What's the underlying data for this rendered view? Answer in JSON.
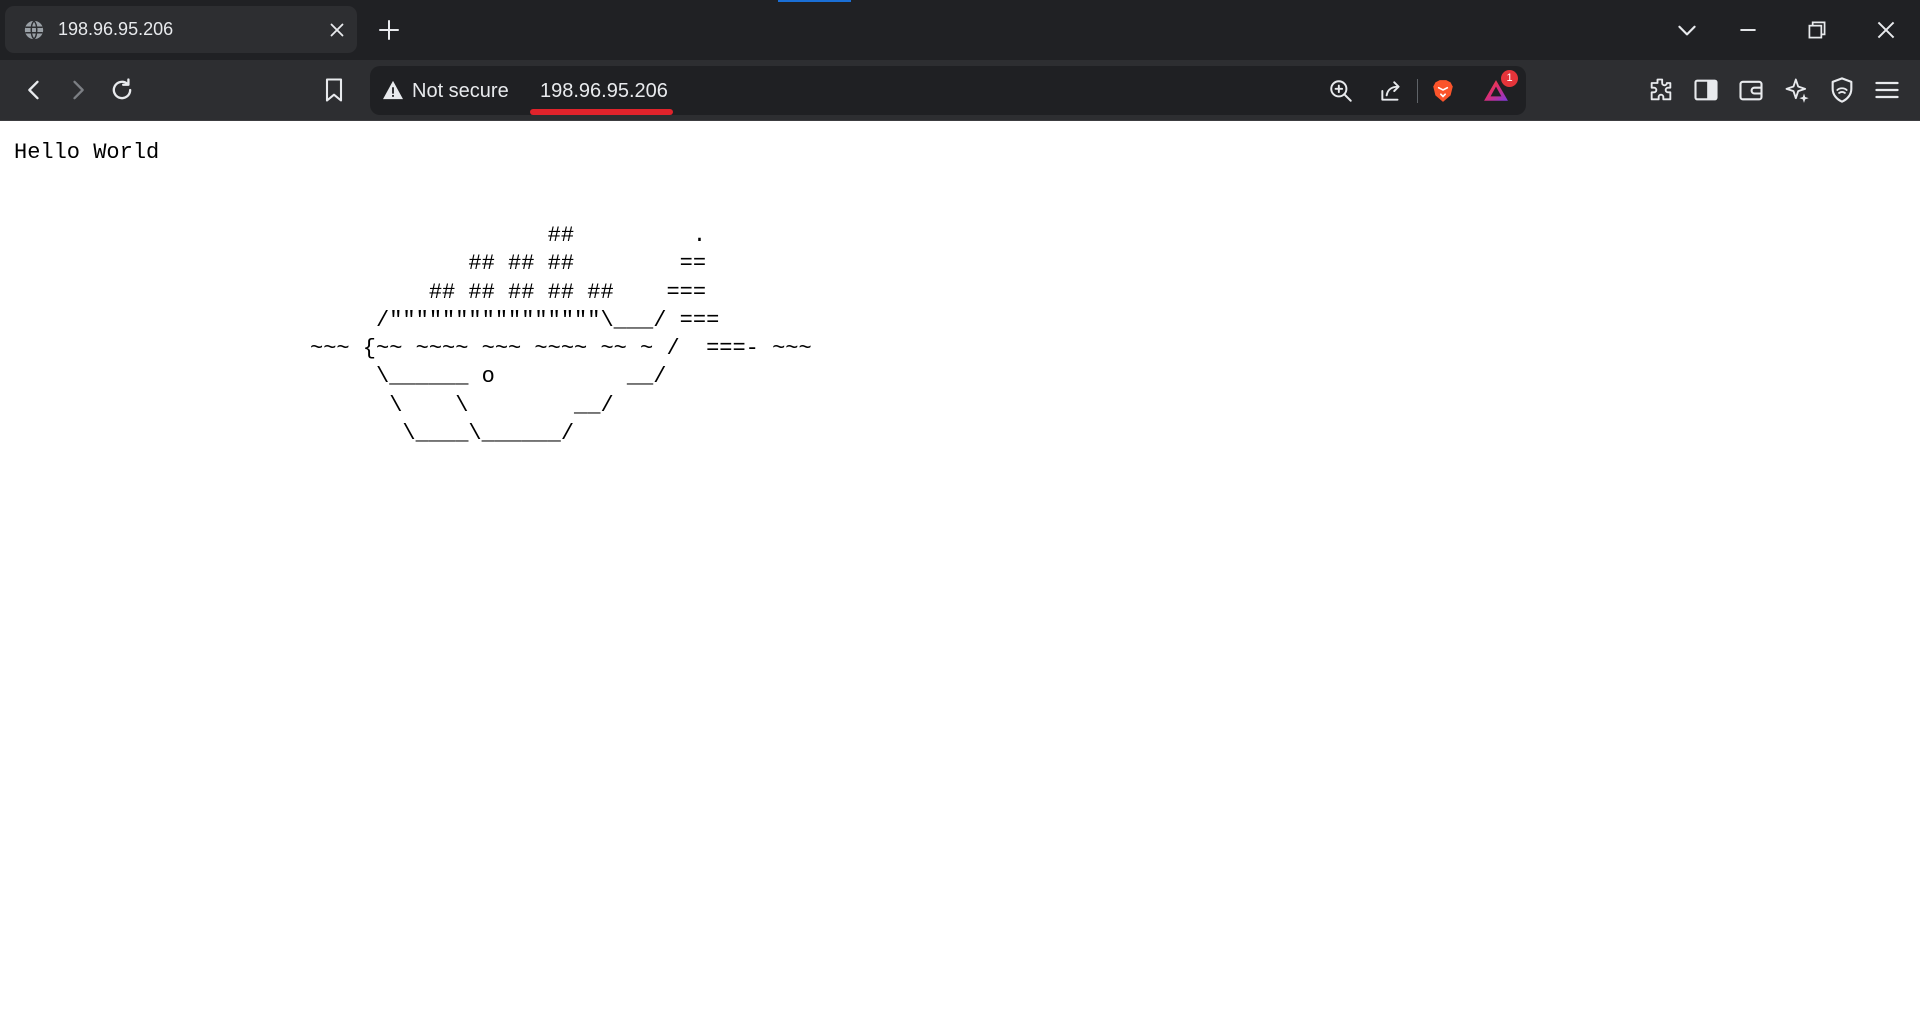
{
  "tab": {
    "title": "198.96.95.206",
    "favicon_icon": "globe-icon"
  },
  "address_bar": {
    "security_label": "Not secure",
    "url": "198.96.95.206",
    "notification_count": "1"
  },
  "page": {
    "greeting": "Hello World",
    "ascii_art": "                  ##         .\n            ## ## ##        ==\n         ## ## ## ## ##    ===\n     /\"\"\"\"\"\"\"\"\"\"\"\"\"\"\"\"\\___/ ===\n~~~ {~~ ~~~~ ~~~ ~~~~ ~~ ~ /  ===- ~~~\n     \\______ o          __/\n      \\    \\        __/\n       \\____\\______/"
  },
  "colors": {
    "chrome_dark": "#202124",
    "toolbar": "#2d2e31",
    "accent_red": "#e0232b",
    "brave_orange": "#fb542b"
  }
}
